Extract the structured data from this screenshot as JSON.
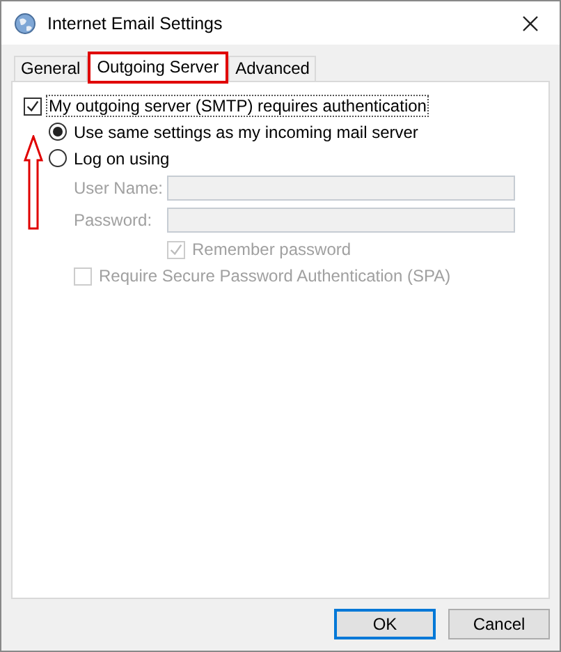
{
  "window": {
    "title": "Internet Email Settings"
  },
  "tabs": [
    {
      "label": "General",
      "selected": false,
      "highlighted": false
    },
    {
      "label": "Outgoing Server",
      "selected": true,
      "highlighted": true
    },
    {
      "label": "Advanced",
      "selected": false,
      "highlighted": false
    }
  ],
  "auth_checkbox": {
    "label": "My outgoing server (SMTP) requires authentication",
    "checked": true,
    "focused": true
  },
  "radios": [
    {
      "label": "Use same settings as my incoming mail server",
      "selected": true
    },
    {
      "label": "Log on using",
      "selected": false
    }
  ],
  "fields": [
    {
      "label": "User Name:",
      "disabled": true
    },
    {
      "label": "Password:",
      "disabled": true
    }
  ],
  "remember": {
    "label": "Remember password",
    "checked": true,
    "disabled": true
  },
  "spa": {
    "label": "Require Secure Password Authentication (SPA)",
    "checked": false,
    "disabled": true
  },
  "annotation_arrow": true,
  "buttons": [
    {
      "label": "OK",
      "default": true
    },
    {
      "label": "Cancel",
      "default": false
    }
  ]
}
